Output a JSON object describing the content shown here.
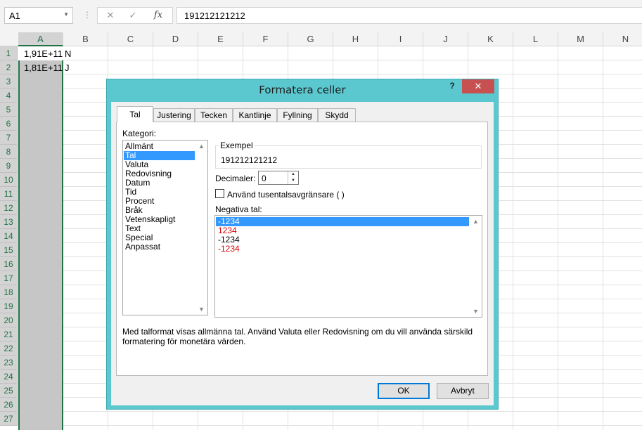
{
  "formula_bar": {
    "name_box": "A1",
    "separator": "⋮",
    "cancel_icon": "✕",
    "enter_icon": "✓",
    "fx_label": "fx",
    "formula_value": "191212121212"
  },
  "grid": {
    "columns": [
      "A",
      "B",
      "C",
      "D",
      "E",
      "F",
      "G",
      "H",
      "I",
      "J",
      "K",
      "L",
      "M",
      "N"
    ],
    "rows": [
      "1",
      "2",
      "3",
      "4",
      "5",
      "6",
      "7",
      "8",
      "9",
      "10",
      "11",
      "12",
      "13",
      "14",
      "15",
      "16",
      "17",
      "18",
      "19",
      "20",
      "21",
      "22",
      "23",
      "24",
      "25",
      "26",
      "27"
    ],
    "cells": {
      "A1": "1,91E+11",
      "A2": "1,81E+11",
      "B1": "N",
      "B2": "J"
    },
    "accent_color": "#217346"
  },
  "dialog": {
    "title": "Formatera celler",
    "help": "?",
    "close": "✕",
    "tabs": [
      "Tal",
      "Justering",
      "Tecken",
      "Kantlinje",
      "Fyllning",
      "Skydd"
    ],
    "active_tab": "Tal",
    "kategori_label": "Kategori:",
    "categories": [
      "Allmänt",
      "Tal",
      "Valuta",
      "Redovisning",
      "Datum",
      "Tid",
      "Procent",
      "Bråk",
      "Vetenskapligt",
      "Text",
      "Special",
      "Anpassat"
    ],
    "selected_category": "Tal",
    "exempel_label": "Exempel",
    "exempel_value": "191212121212",
    "decimaler_label": "Decimaler:",
    "decimaler_value": "0",
    "thousand_separator_label": "Använd tusentalsavgränsare ( )",
    "thousand_separator_checked": false,
    "negativa_label": "Negativa tal:",
    "negative_formats": [
      "-1234",
      "1234",
      "-1234",
      "-1234"
    ],
    "negative_formats_red": [
      false,
      true,
      false,
      true
    ],
    "selected_negative_format": "-1234",
    "description": "Med talformat visas allmänna tal. Använd Valuta eller Redovisning om du vill använda särskild formatering för monetära värden.",
    "ok_label": "OK",
    "cancel_label": "Avbryt",
    "title_bar_color": "#5bc8d0",
    "selection_color": "#3399ff"
  }
}
